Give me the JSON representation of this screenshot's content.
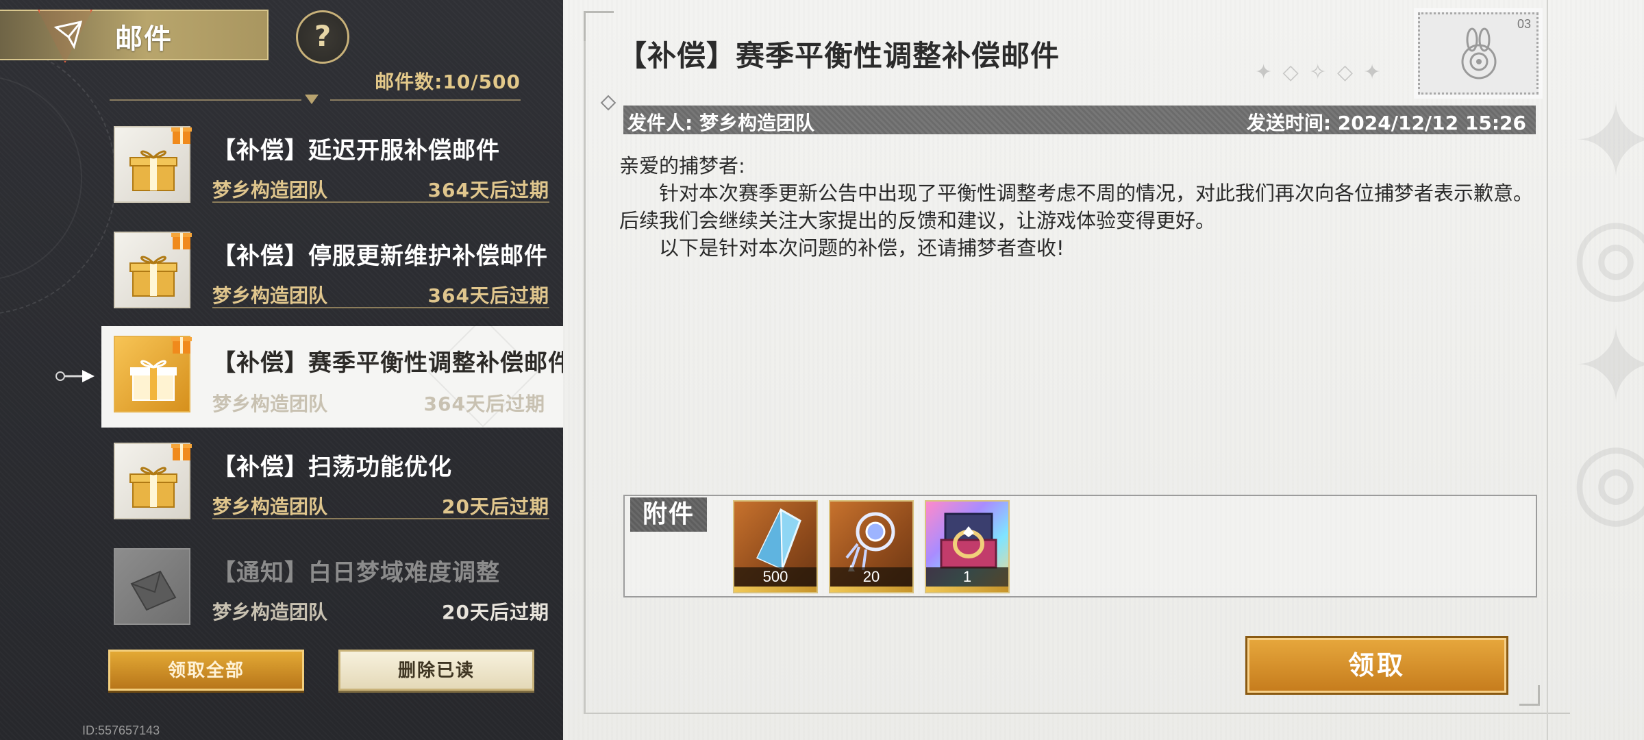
{
  "left_panel": {
    "header_title": "邮件",
    "help_label": "?",
    "mail_count": "邮件数:10/500",
    "mails": [
      {
        "title": "【补偿】延迟开服补偿邮件",
        "sender": "梦乡构造团队",
        "expire": "364天后过期",
        "icon": "gift-icon",
        "state": "normal"
      },
      {
        "title": "【补偿】停服更新维护补偿邮件",
        "sender": "梦乡构造团队",
        "expire": "364天后过期",
        "icon": "gift-icon",
        "state": "normal"
      },
      {
        "title": "【补偿】赛季平衡性调整补偿邮件",
        "sender": "梦乡构造团队",
        "expire": "364天后过期",
        "icon": "gift-icon",
        "state": "selected"
      },
      {
        "title": "【补偿】扫荡功能优化",
        "sender": "梦乡构造团队",
        "expire": "20天后过期",
        "icon": "gift-icon",
        "state": "normal"
      },
      {
        "title": "【通知】白日梦域难度调整",
        "sender": "梦乡构造团队",
        "expire": "20天后过期",
        "icon": "envelope-icon",
        "state": "muted"
      }
    ],
    "claim_all_label": "领取全部",
    "delete_read_label": "删除已读",
    "user_id": "ID:557657143"
  },
  "detail": {
    "title": "【补偿】赛季平衡性调整补偿邮件",
    "stamp_number": "03",
    "sender_label": "发件人: 梦乡构造团队",
    "send_time": "发送时间:  2024/12/12 15:26",
    "greeting": "亲爱的捕梦者:",
    "paragraph_1": "针对本次赛季更新公告中出现了平衡性调整考虑不周的情况，对此我们再次向各位捕梦者表示歉意。后续我们会继续关注大家提出的反馈和建议，让游戏体验变得更好。",
    "paragraph_2": "以下是针对本次问题的补偿，还请捕梦者查收!",
    "attachments_label": "附件",
    "attachments": [
      {
        "icon": "crystal-icon",
        "qty": "500"
      },
      {
        "icon": "dreamcatcher-icon",
        "qty": "20"
      },
      {
        "icon": "ring-box-icon",
        "qty": "1"
      }
    ],
    "claim_label": "领取"
  },
  "colors": {
    "gold": "#e0c68d",
    "claim_orange": "#d48b25",
    "panel_dark": "#2b2c31",
    "paper": "#f1f1ef"
  }
}
